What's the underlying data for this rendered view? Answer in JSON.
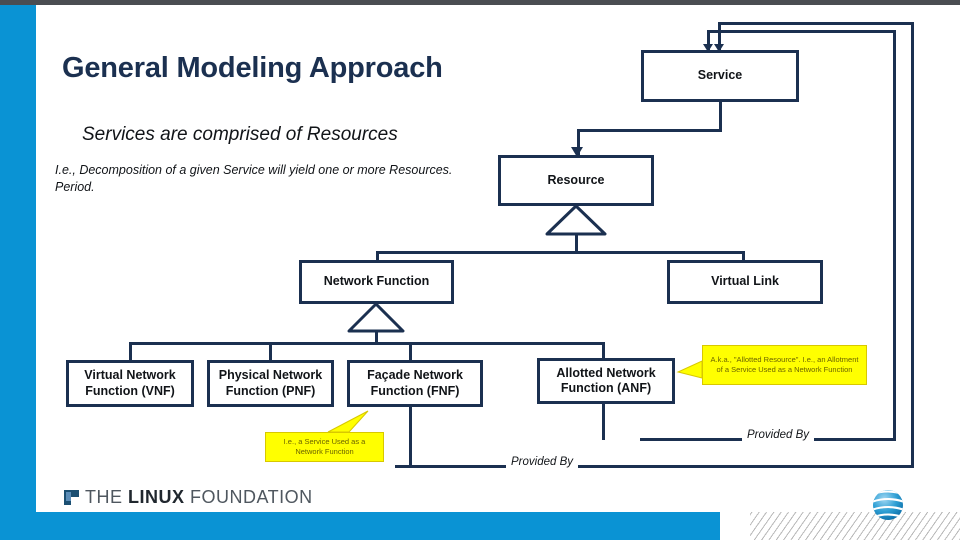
{
  "slide": {
    "title": "General Modeling Approach",
    "subtitle": "Services are comprised of Resources",
    "body": "I.e., Decomposition of a given Service will yield one or more Resources.  Period."
  },
  "theme": {
    "accent_blue": "#0a93d4",
    "navy": "#1b3050",
    "callout_yellow": "#ffff00",
    "top_strip_gray": "#4a4d52"
  },
  "diagram": {
    "type": "uml-class-hierarchy",
    "nodes": [
      {
        "id": "service",
        "label": "Service"
      },
      {
        "id": "resource",
        "label": "Resource"
      },
      {
        "id": "nf",
        "label": "Network Function"
      },
      {
        "id": "vl",
        "label": "Virtual Link"
      },
      {
        "id": "vnf",
        "label": "Virtual Network Function (VNF)"
      },
      {
        "id": "pnf",
        "label": "Physical Network Function (PNF)"
      },
      {
        "id": "fnf",
        "label": "Façade Network Function (FNF)"
      },
      {
        "id": "anf",
        "label": "Allotted Network Function (ANF)"
      }
    ],
    "node_lines": {
      "vnf": [
        "Virtual Network",
        "Function (VNF)"
      ],
      "pnf": [
        "Physical Network",
        "Function (PNF)"
      ],
      "fnf": [
        "Façade Network",
        "Function (FNF)"
      ],
      "anf": [
        "Allotted Network",
        "Function (ANF)"
      ]
    },
    "edge_labels": {
      "fnf_provided_by": "Provided By",
      "anf_provided_by": "Provided By"
    },
    "callouts": [
      {
        "id": "anf-callout",
        "text": "A.k.a., \"Allotted Resource\".  I.e., an Allotment of a Service Used as a Network Function"
      },
      {
        "id": "fnf-callout",
        "text": "I.e., a Service Used as a Network Function"
      }
    ]
  },
  "footer": {
    "linux_foundation": {
      "the": "THE ",
      "linux": "LINUX",
      "foundation": " FOUNDATION"
    },
    "att_logo_alt": "att-globe-logo"
  }
}
